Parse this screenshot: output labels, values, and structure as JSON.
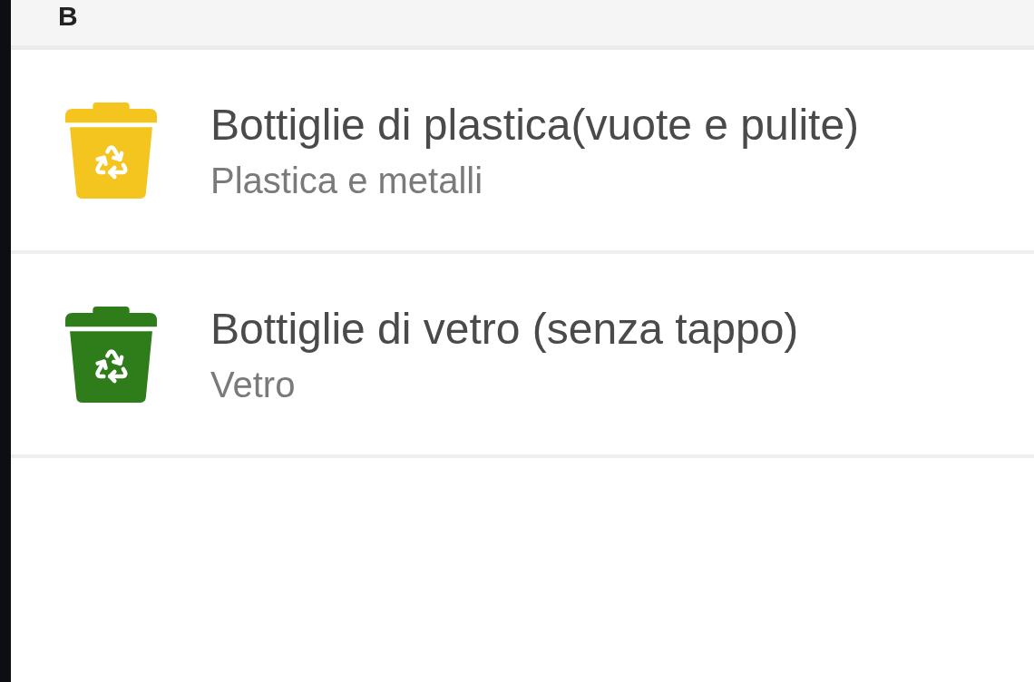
{
  "sections": [
    {
      "letter": "B",
      "items": [
        {
          "title": "Bottiglie di plastica(vuote e pulite)",
          "subtitle": "Plastica e metalli",
          "color": "#f4c41f"
        },
        {
          "title": "Bottiglie di vetro (senza tappo)",
          "subtitle": "Vetro",
          "color": "#2e7d1a"
        }
      ]
    }
  ]
}
